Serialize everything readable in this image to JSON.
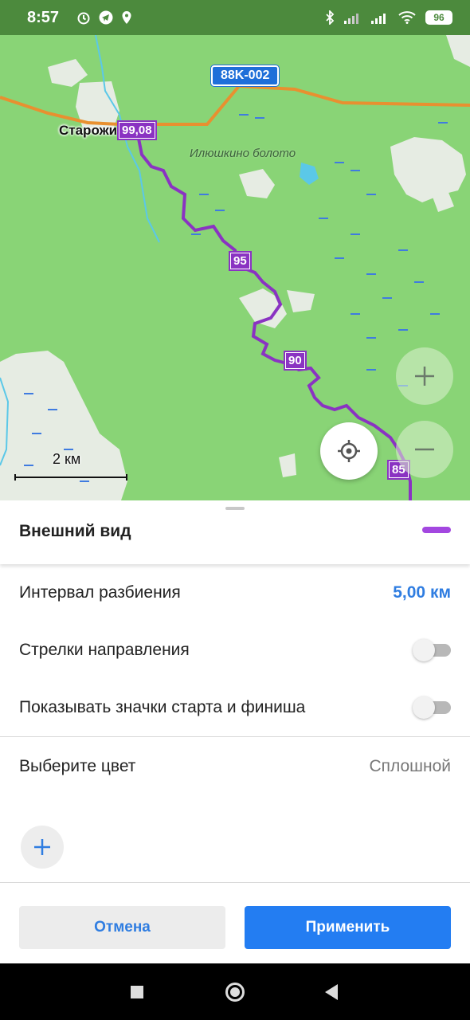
{
  "status_bar": {
    "time": "8:57",
    "battery": "96",
    "icons": [
      "alarm-icon",
      "telegram-icon",
      "location-icon",
      "bluetooth-icon",
      "signal-icon",
      "signal-icon",
      "wifi-icon"
    ]
  },
  "map": {
    "road_shield": "88K-002",
    "town_name": "Старожи",
    "bog_name": "Илюшкино болото",
    "scale_label": "2 км",
    "route_markers": [
      "99,08",
      "95",
      "90",
      "85"
    ],
    "route_color": "#8a33c2",
    "buttons": [
      "zoom-in-icon",
      "zoom-out-icon",
      "my-location-icon"
    ]
  },
  "sheet": {
    "title": "Внешний вид",
    "track_color": "#a347e0",
    "split_interval": {
      "label": "Интервал разбиения",
      "value": "5,00 км"
    },
    "direction_arrows": {
      "label": "Стрелки направления",
      "enabled": false
    },
    "start_finish_icons": {
      "label": "Показывать значки старта и финиша",
      "enabled": false
    },
    "color_choice": {
      "label": "Выберите цвет",
      "value": "Сплошной"
    },
    "cancel_label": "Отмена",
    "apply_label": "Применить",
    "accent_color": "#237df2"
  },
  "nav_bar": {
    "icons": [
      "recents-square-icon",
      "home-circle-icon",
      "back-triangle-icon"
    ]
  }
}
